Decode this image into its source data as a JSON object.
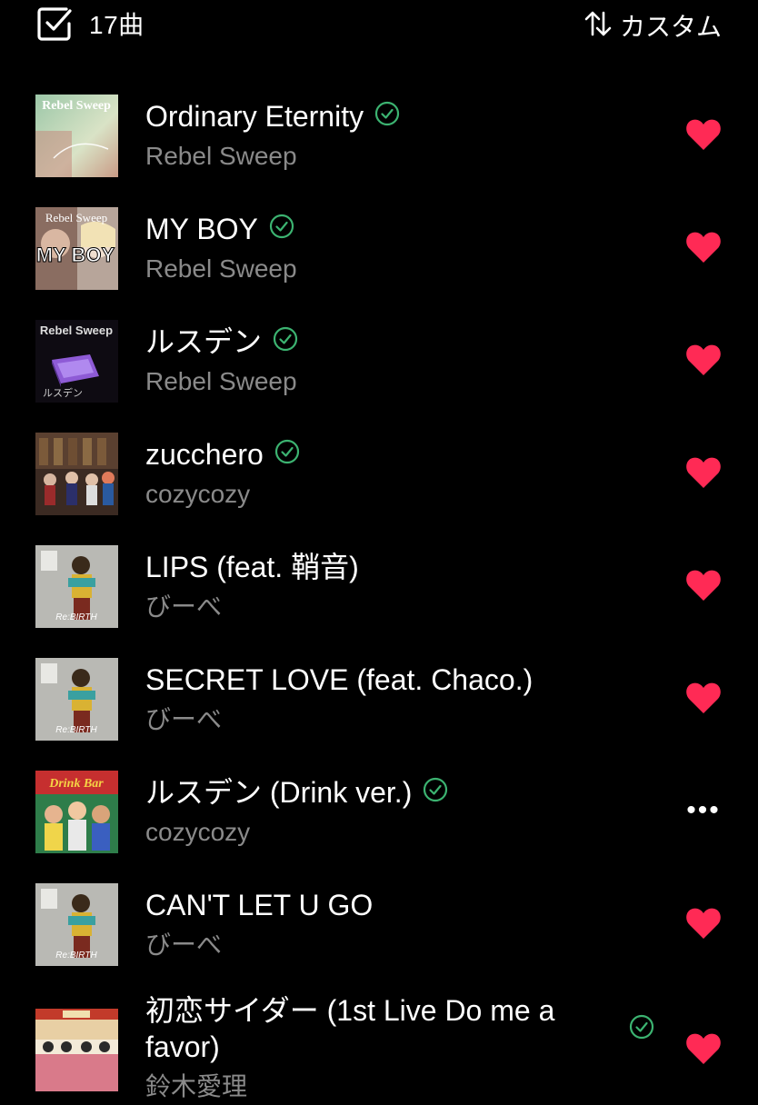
{
  "header": {
    "count_label": "17曲",
    "sort_label": "カスタム",
    "icons": {
      "select": "checkbox-icon",
      "sort": "sort-arrows-icon"
    }
  },
  "colors": {
    "background": "#000000",
    "heart": "#ff2a55",
    "check": "#3cb371",
    "subtext": "#8a8a8a"
  },
  "tracks": [
    {
      "title": "Ordinary Eternity",
      "artist": "Rebel Sweep",
      "downloaded": true,
      "action": "heart",
      "art_text": "Rebel Sweep"
    },
    {
      "title": "MY BOY",
      "artist": "Rebel Sweep",
      "downloaded": true,
      "action": "heart",
      "art_text": "MY BOY"
    },
    {
      "title": "ルスデン",
      "artist": "Rebel Sweep",
      "downloaded": true,
      "action": "heart",
      "art_text": "Rebel Sweep"
    },
    {
      "title": "zucchero",
      "artist": "cozycozy",
      "downloaded": true,
      "action": "heart",
      "art_text": ""
    },
    {
      "title": "LIPS (feat. 鞘音)",
      "artist": "びーべ",
      "downloaded": false,
      "action": "heart",
      "art_text": "Re:BIRTH"
    },
    {
      "title": "SECRET LOVE (feat. Chaco.)",
      "artist": "びーべ",
      "downloaded": false,
      "action": "heart",
      "art_text": "Re:BIRTH"
    },
    {
      "title": "ルスデン (Drink ver.)",
      "artist": "cozycozy",
      "downloaded": true,
      "action": "more",
      "art_text": "Drink Bar",
      "more_label": "•••"
    },
    {
      "title": "CAN'T LET U GO",
      "artist": "びーべ",
      "downloaded": false,
      "action": "heart",
      "art_text": "Re:BIRTH"
    },
    {
      "title": "初恋サイダー (1st Live Do me a favor)",
      "artist": "鈴木愛理",
      "downloaded": true,
      "action": "heart",
      "art_text": ""
    }
  ]
}
